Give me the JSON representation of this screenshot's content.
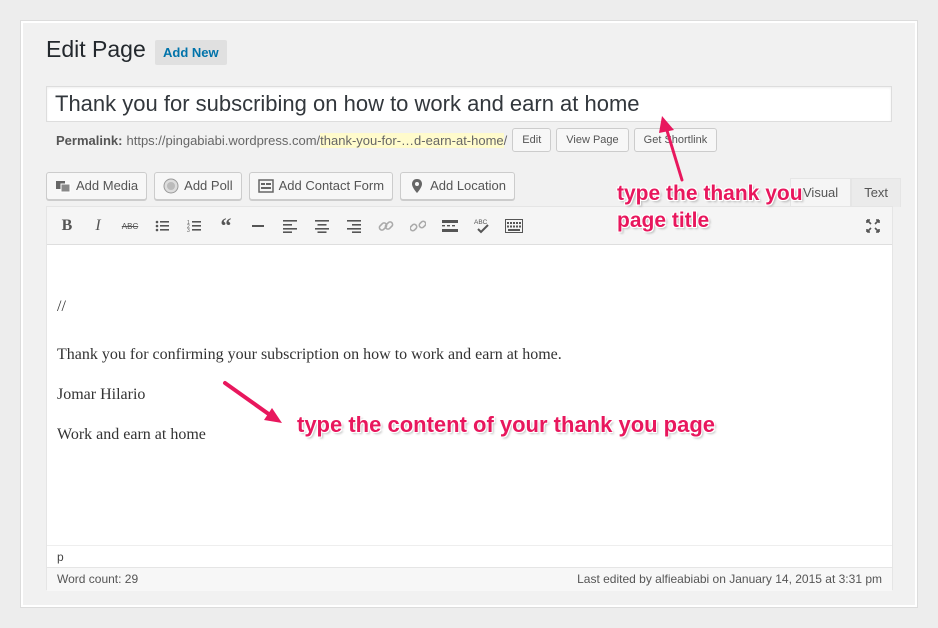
{
  "header": {
    "title": "Edit Page",
    "add_new": "Add New"
  },
  "title_input": {
    "value": "Thank you for subscribing on how to work and earn at home"
  },
  "permalink": {
    "label": "Permalink:",
    "base": "https://pingabiabi.wordpress.com/",
    "slug": "thank-you-for-…d-earn-at-home",
    "trail": "/",
    "buttons": [
      "Edit",
      "View Page",
      "Get Shortlink"
    ]
  },
  "media_buttons": [
    "Add Media",
    "Add Poll",
    "Add Contact Form",
    "Add Location"
  ],
  "tabs": {
    "visual": "Visual",
    "text": "Text"
  },
  "toolbar": {
    "icons": [
      "bold-icon",
      "italic-icon",
      "strikethrough-icon",
      "bullet-list-icon",
      "numbered-list-icon",
      "blockquote-icon",
      "horizontal-line-icon",
      "align-left-icon",
      "align-center-icon",
      "align-right-icon",
      "link-icon",
      "unlink-icon",
      "read-more-icon",
      "spellcheck-icon",
      "toolbar-toggle-icon",
      "fullscreen-icon"
    ]
  },
  "content": {
    "lines": [
      "//",
      "Thank you for confirming your subscription on how to work and earn at home.",
      "Jomar Hilario",
      "Work and earn at home"
    ]
  },
  "path": "p",
  "status": {
    "word_count": "Word count: 29",
    "last_edited": "Last edited by alfieabiabi on January 14, 2015 at 3:31 pm"
  },
  "annotations": {
    "title_note_line1": "type the thank you",
    "title_note_line2": "page title",
    "content_note": "type the content of your thank you page",
    "color": "#e8175d"
  }
}
